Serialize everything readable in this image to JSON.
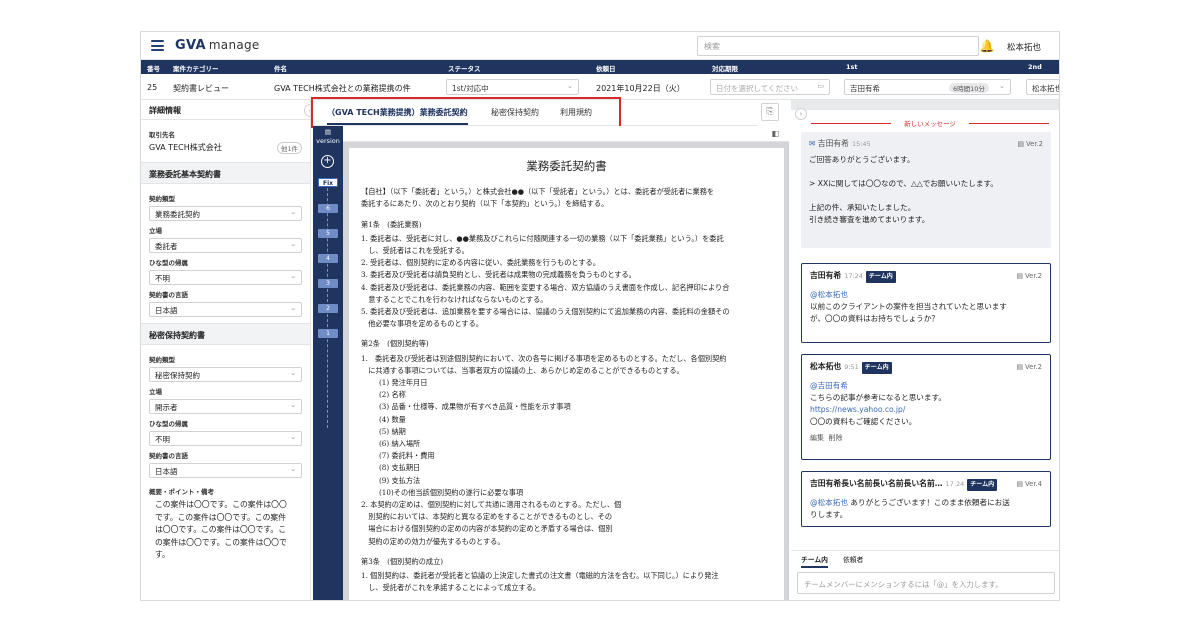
{
  "app": {
    "logo": "GVA",
    "logo_suffix": "manage",
    "search_placeholder": "検索",
    "user": "松本拓也"
  },
  "table_header": [
    "番号",
    "案件カテゴリー",
    "件名",
    "ステータス",
    "依頼日",
    "対応期限",
    "1st",
    "2nd"
  ],
  "row": {
    "number": "25",
    "category": "契約書レビュー",
    "subject": "GVA TECH株式会社との業務提携の件",
    "status": "1st/対応中",
    "request_date": "2021年10月22日（火）",
    "deadline_placeholder": "日付を選択してください",
    "first": "吉田有希",
    "first_badge": "6時間10分",
    "second": "松本拓也"
  },
  "left": {
    "title": "詳細情報",
    "counterparty_label": "取引先名",
    "counterparty": "GVA TECH株式会社",
    "counterparty_tag": "他1件",
    "sec1": "業務委託基本契約書",
    "sec1_fields": [
      {
        "label": "契約類型",
        "value": "業務委託契約"
      },
      {
        "label": "立場",
        "value": "委託者"
      },
      {
        "label": "ひな型の帰属",
        "value": "不明"
      },
      {
        "label": "契約書の言語",
        "value": "日本語"
      }
    ],
    "sec2": "秘密保持契約書",
    "sec2_fields": [
      {
        "label": "契約類型",
        "value": "秘密保持契約"
      },
      {
        "label": "立場",
        "value": "開示者"
      },
      {
        "label": "ひな型の帰属",
        "value": "不明"
      },
      {
        "label": "契約書の言語",
        "value": "日本語"
      }
    ],
    "note_label": "概要・ポイント・備考",
    "note_lines": [
      "この案件は〇〇です。この案件は〇〇",
      "です。この案件は〇〇です。この案件",
      "は〇〇です。この案件は〇〇です。こ",
      "の案件は〇〇です。この案件は〇〇で",
      "す。"
    ]
  },
  "tabs": [
    "（GVA TECH業務提携）業務委託契約",
    "秘密保持契約",
    "利用規約"
  ],
  "version": {
    "label": "version",
    "fix": "Fix",
    "nodes": [
      "6",
      "5",
      "4",
      "3",
      "2",
      "1"
    ]
  },
  "doc": {
    "title": "業務委託契約書",
    "lines": [
      {
        "t": "【自社】（以下「委託者」という。）と株式会社●●（以下「受託者」という。）とは、委託者が受託者に業務を",
        "c": ""
      },
      {
        "t": "委託するにあたり、次のとおり契約（以下「本契約」という。）を締結する。",
        "c": ""
      },
      {
        "t": "第1条　(委託業務)",
        "c": "h"
      },
      {
        "t": "1. 委託者は、受託者に対し、●●業務及びこれらに付随関連する一切の業務（以下「委託業務」という。）を委託",
        "c": ""
      },
      {
        "t": "　し、受託者はこれを受託する。",
        "c": ""
      },
      {
        "t": "2. 受託者は、個別契約に定める内容に従い、委託業務を行うものとする。",
        "c": ""
      },
      {
        "t": "3. 委託者及び受託者は請負契約とし、受託者は成果物の完成義務を負うものとする。",
        "c": ""
      },
      {
        "t": "4. 委託者及び受託者は、委託業務の内容、範囲を変更する場合、双方協議のうえ書面を作成し、記名押印により合",
        "c": ""
      },
      {
        "t": "　意することでこれを行わなければならないものとする。",
        "c": ""
      },
      {
        "t": "5. 委託者及び受託者は、追加業務を要する場合には、協議のうえ個別契約にて追加業務の内容、委託料の金額その",
        "c": ""
      },
      {
        "t": "　他必要な事項を定めるものとする。",
        "c": ""
      },
      {
        "t": "第2条　(個別契約等)",
        "c": "h"
      },
      {
        "t": "1.　委託者及び受託者は別途個別契約において、次の各号に掲げる事項を定めるものとする。ただし、各個別契約",
        "c": ""
      },
      {
        "t": "　に共通する事項については、当事者双方の協議の上、あらかじめ定めることができるものとする。",
        "c": ""
      },
      {
        "t": "(1) 発注年月日",
        "c": "i"
      },
      {
        "t": "(2) 名称",
        "c": "i"
      },
      {
        "t": "(3) 品番・仕様等、成果物が有すべき品質・性能を示す事項",
        "c": "i"
      },
      {
        "t": "(4) 数量",
        "c": "i"
      },
      {
        "t": "(5) 納期",
        "c": "i"
      },
      {
        "t": "(6) 納入場所",
        "c": "i"
      },
      {
        "t": "(7) 委託料・費用",
        "c": "i"
      },
      {
        "t": "(8) 支払期日",
        "c": "i"
      },
      {
        "t": "(9) 支払方法",
        "c": "i"
      },
      {
        "t": "(10)その他当該個別契約の遂行に必要な事項",
        "c": "i"
      },
      {
        "t": "2. 本契約の定めは、個別契約に対して共通に適用されるものとする。ただし、個",
        "c": ""
      },
      {
        "t": "　別契約においては、本契約と異なる定めをすることができるものとし、その",
        "c": ""
      },
      {
        "t": "　場合における個別契約の定めの内容が本契約の定めと矛盾する場合は、個別",
        "c": ""
      },
      {
        "t": "　契約の定めの効力が優先するものとする。",
        "c": ""
      },
      {
        "t": "第3条　(個別契約の成立)",
        "c": "h"
      },
      {
        "t": "1. 個別契約は、委託者が受託者と協議の上決定した書式の注文書（電磁的方法を含む。以下同じ。）により発注",
        "c": ""
      },
      {
        "t": "　し、受託者がこれを承諾することによって成立する。",
        "c": ""
      }
    ]
  },
  "right": {
    "new_message": "新しいメッセージ",
    "messages": [
      {
        "who": "吉田有希",
        "time": "15:45",
        "chip": "",
        "ver": "Ver.2",
        "lines": [
          "ご回答ありがとうございます。",
          "",
          "> XXに関しては〇〇なので、△△でお願いいたします。",
          "",
          "上記の件、承知いたしました。",
          "引き続き審査を進めてまいります。"
        ]
      },
      {
        "who": "吉田有希",
        "time": "17:24",
        "chip": "チーム内",
        "ver": "Ver.2",
        "mention": "@松本拓也",
        "lines": [
          "以前このクライアントの案件を担当されていたと思います",
          "が、〇〇の資料はお持ちでしょうか？"
        ]
      },
      {
        "who": "松本拓也",
        "time": "9:51",
        "chip": "チーム内",
        "ver": "Ver.2",
        "mention": "@吉田有希",
        "lines": [
          "こちらの記事が参考になると思います。"
        ],
        "link": "https://news.yahoo.co.jp/",
        "after": "〇〇の資料もご確認ください。",
        "actions": [
          "編集",
          "削除"
        ]
      },
      {
        "who": "吉田有希長い名前長い名前長い名前…",
        "time": "17:24",
        "chip": "チーム内",
        "ver": "Ver.4",
        "mention": "@松本拓也",
        "inline": "ありがとうございます！このまま依頼者にお送",
        "lines": [
          "りします。"
        ]
      }
    ],
    "tabs": [
      "チーム内",
      "依頼者"
    ],
    "input_placeholder": "チームメンバーにメンションするには「@」を入力します。"
  }
}
